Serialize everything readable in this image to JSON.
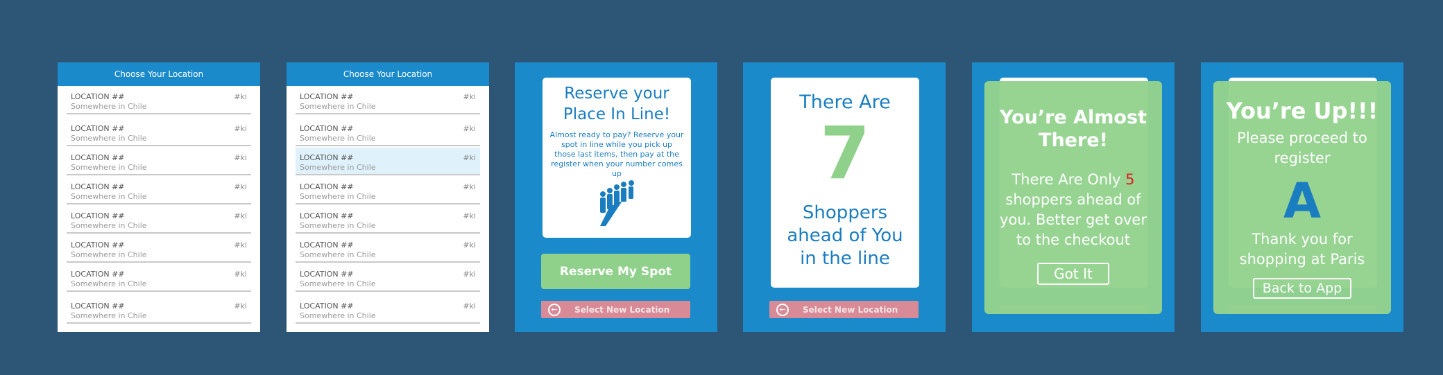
{
  "screen1": {
    "header": "Choose Your Location",
    "rows": [
      {
        "name": "LOCATION ##",
        "sub": "Somewhere in Chile",
        "code": "#ki"
      },
      {
        "name": "LOCATION ##",
        "sub": "Somewhere in Chile",
        "code": "#ki"
      },
      {
        "name": "LOCATION ##",
        "sub": "Somewhere in Chile",
        "code": "#ki"
      },
      {
        "name": "LOCATION ##",
        "sub": "Somewhere in Chile",
        "code": "#ki"
      },
      {
        "name": "LOCATION ##",
        "sub": "Somewhere in Chile",
        "code": "#ki"
      },
      {
        "name": "LOCATION ##",
        "sub": "Somewhere in Chile",
        "code": "#ki"
      },
      {
        "name": "LOCATION ##",
        "sub": "Somewhere in Chile",
        "code": "#ki"
      },
      {
        "name": "LOCATION ##",
        "sub": "Somewhere in Chile",
        "code": "#ki"
      }
    ]
  },
  "screen2": {
    "header": "Choose Your Location",
    "selected_index": 2,
    "rows": [
      {
        "name": "LOCATION ##",
        "sub": "Somewhere in Chile",
        "code": "#ki"
      },
      {
        "name": "LOCATION ##",
        "sub": "Somewhere in Chile",
        "code": "#ki"
      },
      {
        "name": "LOCATION ##",
        "sub": "Somewhere in Chile",
        "code": "#ki"
      },
      {
        "name": "LOCATION ##",
        "sub": "Somewhere in Chile",
        "code": "#ki"
      },
      {
        "name": "LOCATION ##",
        "sub": "Somewhere in Chile",
        "code": "#ki"
      },
      {
        "name": "LOCATION ##",
        "sub": "Somewhere in Chile",
        "code": "#ki"
      },
      {
        "name": "LOCATION ##",
        "sub": "Somewhere in Chile",
        "code": "#ki"
      },
      {
        "name": "LOCATION ##",
        "sub": "Somewhere in Chile",
        "code": "#ki"
      }
    ]
  },
  "screen3": {
    "title_line1": "Reserve your",
    "title_line2": "Place In Line!",
    "body": "Almost ready to pay?  Reserve your spot in line while you pick up those last items, then pay at the register when your number comes up",
    "icon": "queue-people-icon",
    "reserve_button": "Reserve My Spot",
    "location_button": "Select New Location"
  },
  "screen4": {
    "line1": "There Are",
    "count": "7",
    "line2": "Shoppers",
    "line3": "ahead of You",
    "line4": "in the line",
    "location_button": "Select New Location"
  },
  "screen5": {
    "title_line1": "You’re Almost",
    "title_line2": "There!",
    "msg_before": "There Are Only ",
    "msg_count": "5",
    "msg_after": " shoppers ahead of you. Better get over to the checkout",
    "button": "Got It"
  },
  "screen6": {
    "title": "You’re Up!!!",
    "line1": "Please proceed to register",
    "register": "A",
    "line2": "Thank you for shopping at Paris",
    "button": "Back to App"
  },
  "colors": {
    "background": "#2c5576",
    "brand_blue": "#1a8acb",
    "green": "#8fd18a",
    "pink": "#d88a96",
    "alert_red": "#e02020"
  }
}
